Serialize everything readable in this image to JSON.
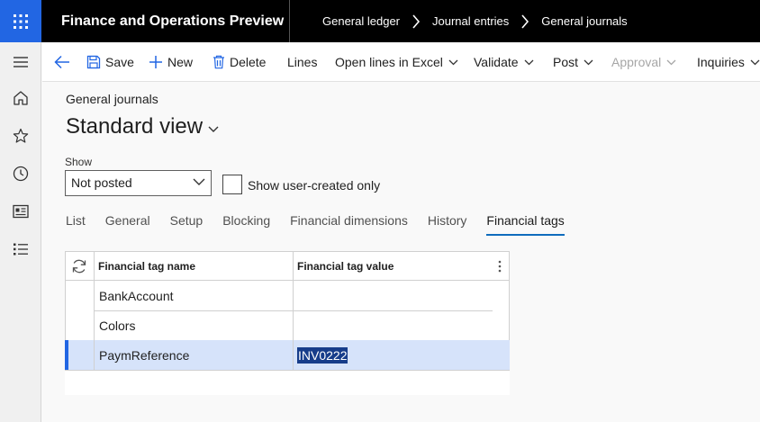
{
  "app": {
    "title": "Finance and Operations Preview"
  },
  "breadcrumb": {
    "items": [
      "General ledger",
      "Journal entries",
      "General journals"
    ]
  },
  "nav": {
    "icons": [
      "hamburger-icon",
      "home-icon",
      "star-icon",
      "clock-icon",
      "workspace-icon",
      "list-icon"
    ]
  },
  "toolbar": {
    "save_label": "Save",
    "new_label": "New",
    "delete_label": "Delete",
    "lines_label": "Lines",
    "open_excel_label": "Open lines in Excel",
    "validate_label": "Validate",
    "post_label": "Post",
    "approval_label": "Approval",
    "inquiries_label": "Inquiries"
  },
  "page": {
    "caption": "General journals",
    "view_title": "Standard view"
  },
  "filters": {
    "show_label": "Show",
    "show_value": "Not posted",
    "user_created_label": "Show user-created only",
    "user_created_checked": false
  },
  "tabs": [
    "List",
    "General",
    "Setup",
    "Blocking",
    "Financial dimensions",
    "History",
    "Financial tags"
  ],
  "active_tab": "Financial tags",
  "grid": {
    "headers": {
      "name": "Financial tag name",
      "value": "Financial tag value"
    },
    "rows": [
      {
        "name": "BankAccount",
        "value": ""
      },
      {
        "name": "Colors",
        "value": ""
      },
      {
        "name": "PaymReference",
        "value": "INV0222"
      }
    ],
    "selected_row": 2
  },
  "colors": {
    "accent": "#2266e3",
    "selected_row": "#d6e3fa",
    "tab_underline": "#0f6cbd"
  }
}
